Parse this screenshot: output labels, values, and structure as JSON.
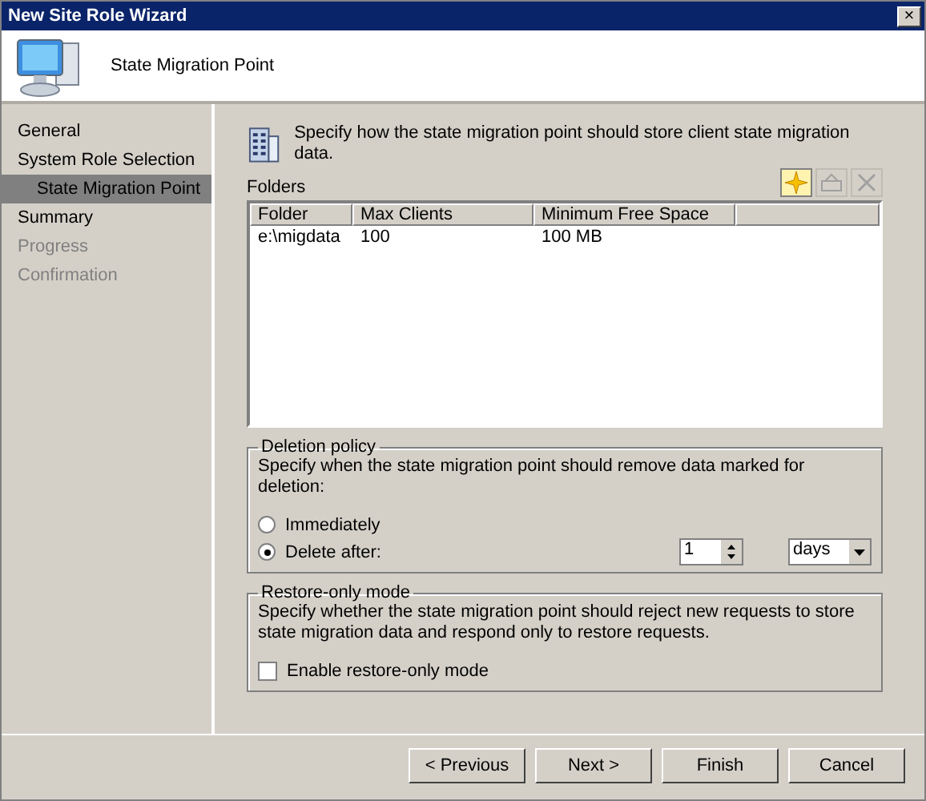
{
  "window": {
    "title": "New Site Role Wizard",
    "close": "×"
  },
  "header": {
    "title": "State Migration Point"
  },
  "sidebar": {
    "items": [
      {
        "label": "General",
        "selected": false,
        "disabled": false
      },
      {
        "label": "System Role Selection",
        "selected": false,
        "disabled": false,
        "children": [
          {
            "label": "State Migration Point",
            "selected": true,
            "disabled": false
          }
        ]
      },
      {
        "label": "Summary",
        "selected": false,
        "disabled": false
      },
      {
        "label": "Progress",
        "selected": false,
        "disabled": true
      },
      {
        "label": "Confirmation",
        "selected": false,
        "disabled": true
      }
    ]
  },
  "intro": "Specify how the state migration point should store client state migration data.",
  "folders": {
    "label": "Folders",
    "toolbar": [
      {
        "kind": "new",
        "disabled": false
      },
      {
        "kind": "properties",
        "disabled": true
      },
      {
        "kind": "delete",
        "disabled": true
      }
    ],
    "columns": [
      "Folder",
      "Max Clients",
      "Minimum Free Space"
    ],
    "rows": [
      [
        "e:\\migdata",
        "100",
        "100 MB"
      ]
    ]
  },
  "deletion_policy": {
    "title": "Deletion policy",
    "description": "Specify when the state migration point should remove data marked for deletion:",
    "options": [
      {
        "label": "Immediately",
        "selected": false
      },
      {
        "label": "Delete after:",
        "selected": true
      }
    ],
    "spinner": {
      "value": "1"
    },
    "unit": {
      "value": "days"
    }
  },
  "restore_only": {
    "title": "Restore-only mode",
    "description": "Specify whether the state migration point should reject new requests to store state migration data and respond only to restore requests.",
    "checkbox": {
      "label": "Enable restore-only mode",
      "checked": false
    }
  },
  "buttons": [
    {
      "label": "< Previous",
      "disabled": false
    },
    {
      "label": "Next >",
      "disabled": false
    },
    {
      "label": "Finish",
      "disabled": false
    },
    {
      "label": "Cancel",
      "disabled": false
    }
  ]
}
